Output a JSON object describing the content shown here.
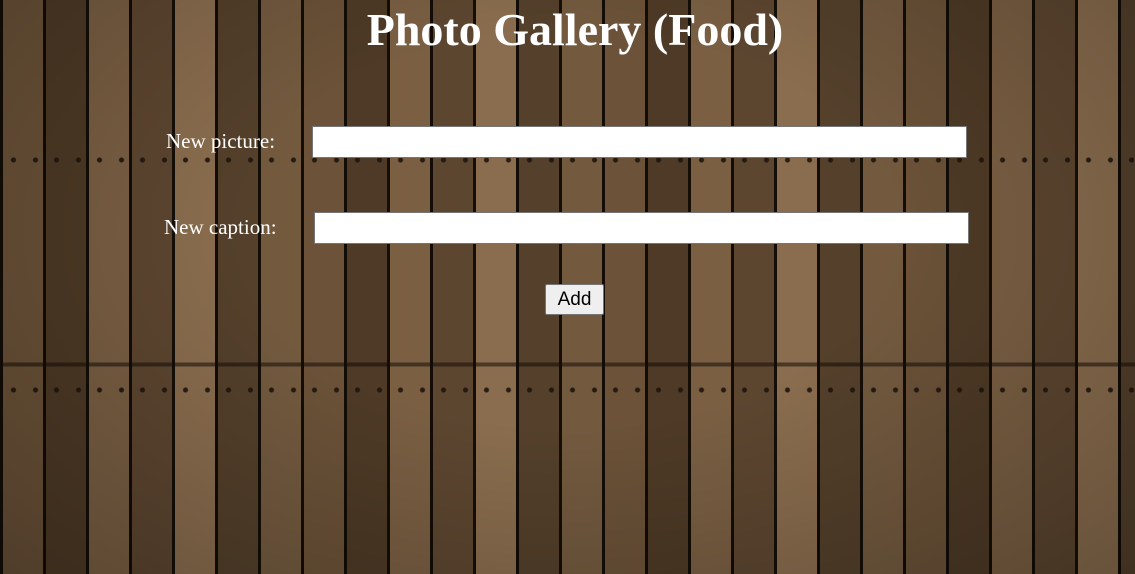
{
  "page": {
    "title": "Photo Gallery (Food)"
  },
  "form": {
    "picture": {
      "label": "New picture:",
      "value": "",
      "placeholder": ""
    },
    "caption": {
      "label": "New caption:",
      "value": "",
      "placeholder": ""
    },
    "add_button_label": "Add"
  },
  "colors": {
    "text": "#ffffff",
    "wood_background": "#5a4530"
  }
}
